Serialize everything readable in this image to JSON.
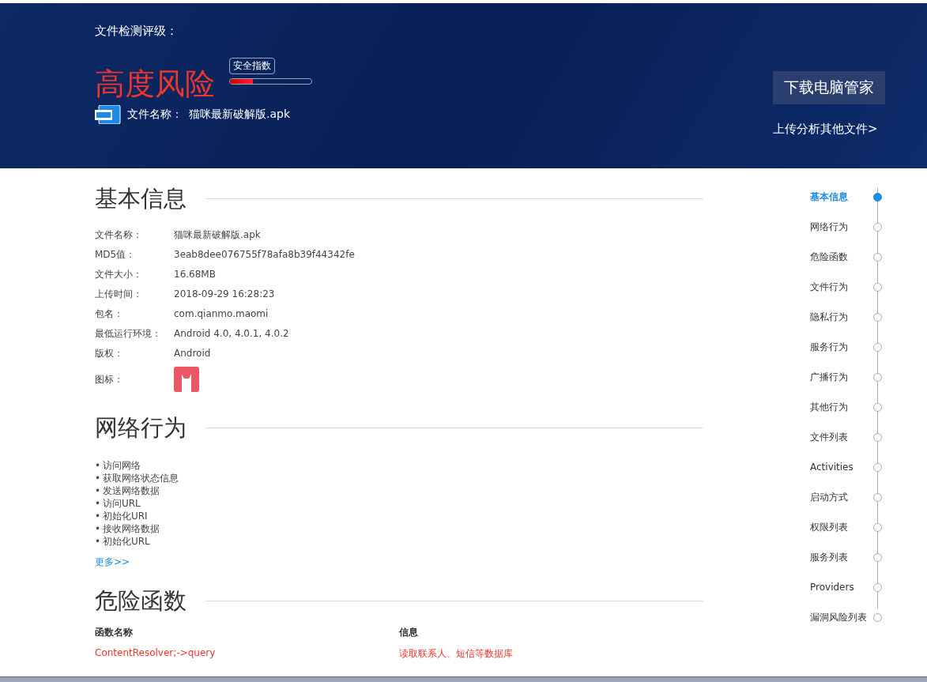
{
  "header": {
    "rating_label": "文件检测评级：",
    "risk_level": "高度风险",
    "meter": {
      "label": "安全指数",
      "level": 0.28
    },
    "file_label": "文件名称：",
    "file_name": "猫咪最新破解版.apk",
    "download_button": "下载电脑管家",
    "upload_link": "上传分析其他文件>"
  },
  "basic_info": {
    "title": "基本信息",
    "rows": [
      {
        "kind": "text",
        "label": "文件名称：",
        "value": "猫咪最新破解版.apk"
      },
      {
        "kind": "text",
        "label": "MD5值：",
        "value": "3eab8dee076755f78afa8b39f44342fe"
      },
      {
        "kind": "text",
        "label": "文件大小：",
        "value": "16.68MB"
      },
      {
        "kind": "text",
        "label": "上传时间：",
        "value": "2018-09-29 16:28:23"
      },
      {
        "kind": "text",
        "label": "包名：",
        "value": "com.qianmo.maomi"
      },
      {
        "kind": "text",
        "label": "最低运行环境：",
        "value": "Android 4.0, 4.0.1, 4.0.2"
      },
      {
        "kind": "text",
        "label": "版权：",
        "value": "Android"
      },
      {
        "kind": "icon",
        "label": "图标："
      }
    ]
  },
  "network": {
    "title": "网络行为",
    "marker": "•",
    "items": [
      "访问网络",
      "获取网络状态信息",
      "发送网络数据",
      "访问URL",
      "初始化URI",
      "接收网络数据",
      "初始化URL"
    ],
    "more_link": "更多>>"
  },
  "danger": {
    "title": "危险函数",
    "columns": [
      "函数名称",
      "信息"
    ],
    "rows": [
      [
        "ContentResolver;->query",
        "读取联系人、短信等数据库"
      ]
    ]
  },
  "nav": {
    "items": [
      {
        "label": "基本信息",
        "selected": true
      },
      {
        "label": "网络行为",
        "selected": false
      },
      {
        "label": "危险函数",
        "selected": false
      },
      {
        "label": "文件行为",
        "selected": false
      },
      {
        "label": "隐私行为",
        "selected": false
      },
      {
        "label": "服务行为",
        "selected": false
      },
      {
        "label": "广播行为",
        "selected": false
      },
      {
        "label": "其他行为",
        "selected": false
      },
      {
        "label": "文件列表",
        "selected": false
      },
      {
        "label": "Activities",
        "selected": false
      },
      {
        "label": "启动方式",
        "selected": false
      },
      {
        "label": "权限列表",
        "selected": false
      },
      {
        "label": "服务列表",
        "selected": false
      },
      {
        "label": "Providers",
        "selected": false
      },
      {
        "label": "漏洞风险列表",
        "selected": false
      }
    ]
  }
}
